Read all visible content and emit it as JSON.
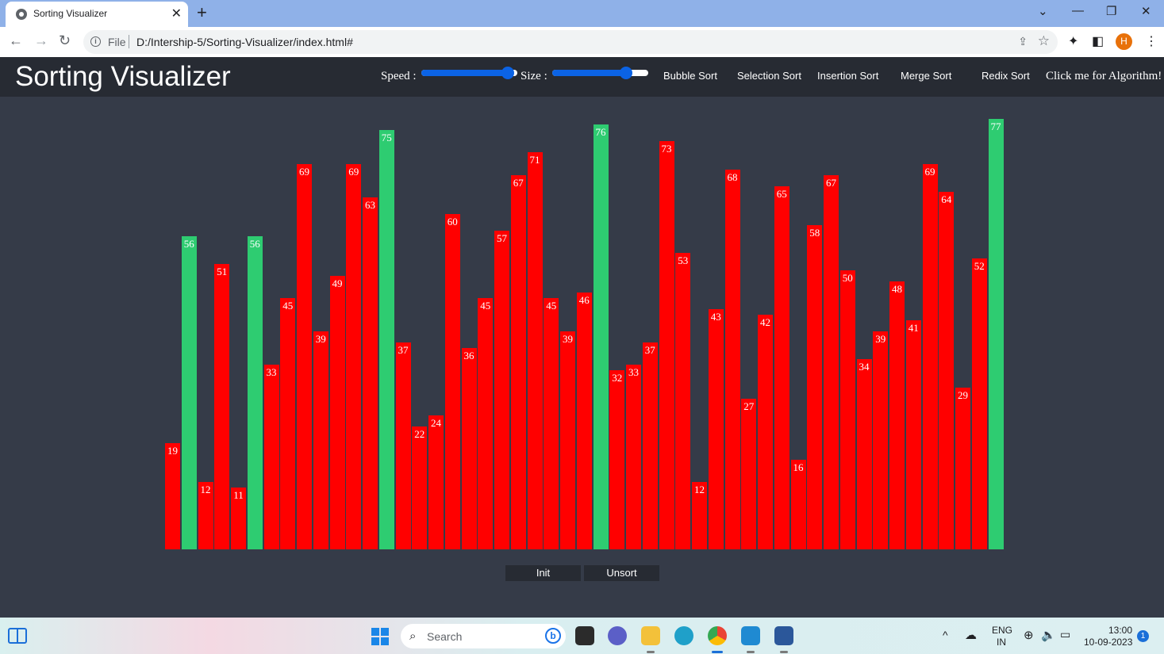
{
  "browser": {
    "tab_title": "Sorting Visualizer",
    "tab_close": "✕",
    "new_tab": "+",
    "scheme_label": "File",
    "url": "D:/Intership-5/Sorting-Visualizer/index.html#",
    "profile_initial": "H"
  },
  "app": {
    "title": "Sorting Visualizer",
    "speed_label": "Speed :",
    "size_label": "Size :",
    "speed_value": 0.9,
    "size_value": 0.77,
    "algorithms": [
      "Bubble Sort",
      "Selection Sort",
      "Insertion Sort",
      "Merge Sort",
      "Redix Sort"
    ],
    "algorithm_link": "Click me for Algorithm!",
    "init_label": "Init",
    "unsort_label": "Unsort",
    "colors": {
      "bar": "#ff0000",
      "bar_highlight": "#2ecc71",
      "background": "#353b48",
      "header": "#272b33"
    }
  },
  "bars": {
    "values": [
      19,
      56,
      12,
      51,
      11,
      56,
      33,
      45,
      69,
      39,
      49,
      69,
      63,
      75,
      37,
      22,
      24,
      60,
      36,
      45,
      57,
      67,
      71,
      45,
      39,
      46,
      76,
      32,
      33,
      37,
      73,
      53,
      12,
      43,
      68,
      27,
      42,
      65,
      16,
      58,
      67,
      50,
      34,
      39,
      48,
      41,
      69,
      64,
      29,
      52,
      77
    ],
    "highlighted": [
      1,
      5,
      13,
      26,
      50
    ]
  },
  "taskbar": {
    "search_label": "Search",
    "lang_line1": "ENG",
    "lang_line2": "IN",
    "time": "13:00",
    "date": "10-09-2023",
    "notification_count": "1"
  }
}
